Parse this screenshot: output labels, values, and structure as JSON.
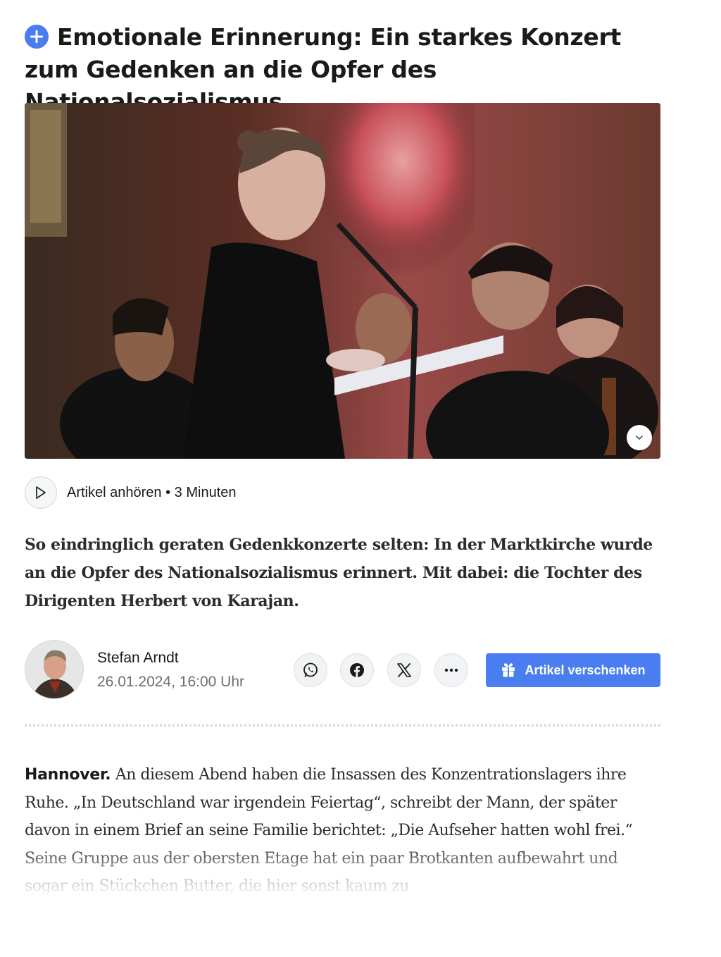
{
  "article": {
    "title": "Emotionale Erinnerung: Ein starkes Konzert zum Gedenken an die Opfer des Nationalsozialismus",
    "premium_icon": "plus-icon",
    "hero_image": {
      "expand_icon": "chevron-down-icon"
    },
    "audio": {
      "play_icon": "play-icon",
      "label": "Artikel anhören",
      "separator": "•",
      "duration": "3 Minuten"
    },
    "lead": "So eindringlich geraten Gedenkkonzerte selten: In der Marktkirche wurde an die Opfer des Nationalsozialismus erinnert. Mit dabei: die Tochter des Dirigenten Herbert von Karajan.",
    "author": {
      "name": "Stefan Arndt",
      "date": "26.01.2024, 16:00 Uhr"
    },
    "share": {
      "buttons": [
        "whatsapp-icon",
        "facebook-icon",
        "x-icon",
        "more-icon"
      ],
      "gift_label": "Artikel verschenken",
      "gift_icon": "gift-icon"
    },
    "body": {
      "dateline": "Hannover.",
      "text": " An diesem Abend haben die Insassen des Konzentrationslagers ihre Ruhe. „In Deutschland war irgendein Feiertag“, schreibt der Mann, der später davon in einem Brief an seine Familie berichtet: „Die Aufseher hatten wohl frei.“ Seine Gruppe aus der obersten Etage hat ein paar Brotkanten aufbewahrt und sogar ein Stückchen Butter, die hier sonst kaum zu"
    }
  },
  "colors": {
    "accent": "#4a7ef0",
    "text": "#1a1a1a",
    "muted": "#6e6e6e"
  }
}
